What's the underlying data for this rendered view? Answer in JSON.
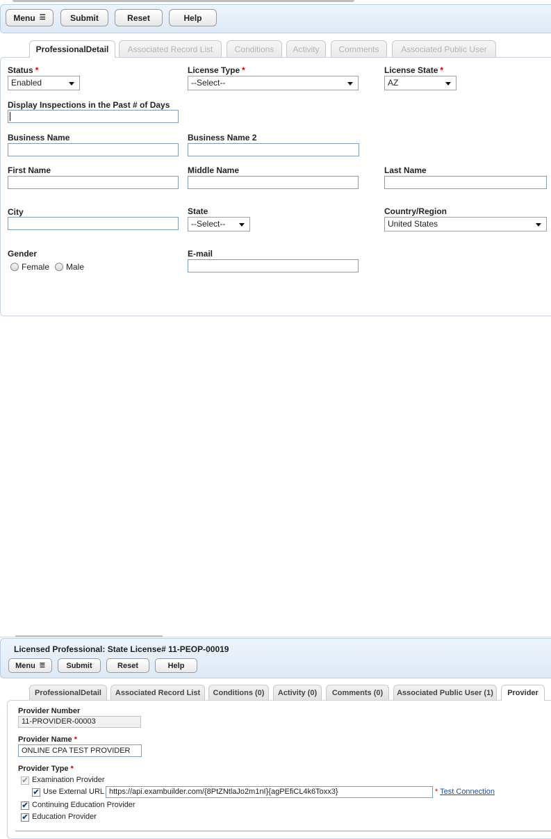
{
  "top": {
    "toolbar": {
      "menu": "Menu",
      "submit": "Submit",
      "reset": "Reset",
      "help": "Help"
    },
    "tabs": [
      "ProfessionalDetail",
      "Associated Record List",
      "Conditions",
      "Activity",
      "Comments",
      "Associated Public User"
    ],
    "form": {
      "status_label": "Status",
      "status_value": "Enabled",
      "license_type_label": "License Type",
      "license_type_value": "--Select--",
      "license_state_label": "License State",
      "license_state_value": "AZ",
      "inspections_label": "Display Inspections in the Past # of Days",
      "business_name_label": "Business Name",
      "business_name2_label": "Business Name 2",
      "first_name_label": "First Name",
      "middle_name_label": "Middle Name",
      "last_name_label": "Last Name",
      "city_label": "City",
      "state_label": "State",
      "state_value": "--Select--",
      "country_label": "Country/Region",
      "country_value": "United States",
      "gender_label": "Gender",
      "gender_female": "Female",
      "gender_male": "Male",
      "email_label": "E-mail",
      "required_mark": "*"
    }
  },
  "bottom": {
    "title": "Licensed Professional: State License# 11-PEOP-00019",
    "toolbar": {
      "menu": "Menu",
      "submit": "Submit",
      "reset": "Reset",
      "help": "Help"
    },
    "tabs": [
      "ProfessionalDetail",
      "Associated Record List",
      "Conditions (0)",
      "Activity (0)",
      "Comments (0)",
      "Associated Public User (1)",
      "Provider"
    ],
    "form": {
      "provider_number_label": "Provider Number",
      "provider_number_value": "11-PROVIDER-00003",
      "provider_name_label": "Provider Name",
      "provider_name_value": "ONLINE CPA TEST PROVIDER",
      "provider_type_label": "Provider Type",
      "examination_provider": "Examination Provider",
      "use_external_url": "Use External URL",
      "external_url_value": "https://api.exambuilder.com/{8PtZNtlaJo2m1nI}{agPEfiCL4k6Toxx3}",
      "test_connection": "Test Connection",
      "continuing_education": "Continuing Education Provider",
      "education_provider": "Education Provider",
      "required_mark": "*",
      "check_mark": "✔"
    }
  }
}
